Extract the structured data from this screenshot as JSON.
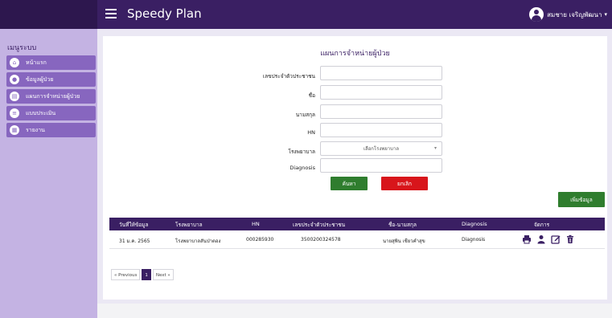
{
  "app": {
    "title": "Speedy Plan"
  },
  "user": {
    "name": "สมชาย เจริญพัฒนา"
  },
  "sidebar": {
    "heading": "เมนูระบบ",
    "items": [
      {
        "label": "หน้าแรก",
        "icon": "home-icon"
      },
      {
        "label": "ข้อมูลผู้ป่วย",
        "icon": "user-icon"
      },
      {
        "label": "แผนการจำหน่ายผู้ป่วย",
        "icon": "clipboard-icon"
      },
      {
        "label": "แบบประเมิน",
        "icon": "list-icon"
      },
      {
        "label": "รายงาน",
        "icon": "report-icon"
      }
    ]
  },
  "form": {
    "title": "แผนการจำหน่ายผู้ป่วย",
    "fields": {
      "citizen_id": {
        "label": "เลขประจำตัวประชาชน",
        "value": ""
      },
      "first_name": {
        "label": "ชื่อ",
        "value": ""
      },
      "last_name": {
        "label": "นามสกุล",
        "value": ""
      },
      "hn": {
        "label": "HN",
        "value": ""
      },
      "hospital": {
        "label": "โรงพยาบาล",
        "selected": "เลือกโรงพยาบาล"
      },
      "diagnosis": {
        "label": "Diagnosis",
        "value": ""
      }
    },
    "search_label": "ค้นหา",
    "cancel_label": "ยกเลิก"
  },
  "add_label": "เพิ่มข้อมูล",
  "table": {
    "headers": [
      "วันที่ให้ข้อมูล",
      "โรงพยาบาล",
      "HN",
      "เลขประจำตัวประชาชน",
      "ชื่อ-นามสกุล",
      "Diagnosis",
      "จัดการ"
    ],
    "rows": [
      [
        "31 ม.ค. 2565",
        "โรงพยาบาลสันป่าตอง",
        "000285930",
        "3500200324578",
        "นายสุพิน เชียวคำสุข",
        "Diagnosis"
      ]
    ],
    "actions": [
      "print-icon",
      "user-icon",
      "edit-icon",
      "trash-icon"
    ]
  },
  "pagination": {
    "previous": "« Previous",
    "current": "1",
    "next": "Next »"
  },
  "colors": {
    "primary": "#3a1f63",
    "sidebar": "#c4b3e3",
    "menu": "#8766bf",
    "success": "#2f7d2e",
    "danger": "#d8151b"
  }
}
